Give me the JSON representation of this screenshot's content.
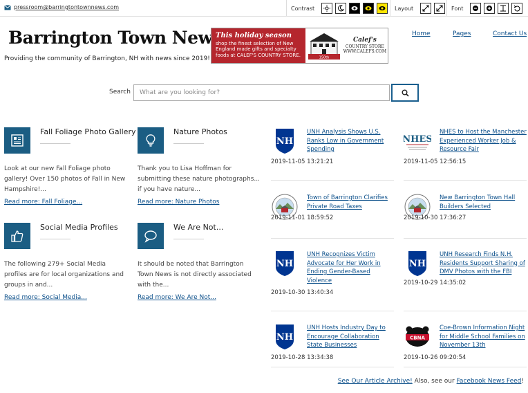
{
  "topbar": {
    "email": "pressroom@barringtontownnews.com",
    "contrast_label": "Contrast",
    "layout_label": "Layout",
    "font_label": "Font"
  },
  "header": {
    "logo": "Barrington Town News",
    "tagline": "Providing the community of Barrington, NH with news since 2019!",
    "ad": {
      "headline": "This holiday season",
      "text": "shop the finest selection of New England made gifts and specialty foods at CALEF'S COUNTRY STORE.",
      "brand": "Calef's",
      "brand_sub": "COUNTRY STORE",
      "anniversary": "150th",
      "url": "WWW.CALEFS.COM"
    },
    "nav": [
      {
        "label": "Home"
      },
      {
        "label": "Pages"
      },
      {
        "label": "Contact Us"
      }
    ]
  },
  "search": {
    "label": "Search",
    "placeholder": "What are you looking for?"
  },
  "features": [
    {
      "title": "Fall Foliage Photo Gallery",
      "icon": "document-icon",
      "desc": "Look at our new Fall Foliage photo gallery! Over 150 photos of Fall in New Hampshire!...",
      "more": "Read more: Fall Foliage..."
    },
    {
      "title": "Nature Photos",
      "icon": "lightbulb-icon",
      "desc": "Thank you to Lisa Hoffman for submitting these nature photographs... if you have nature...",
      "more": "Read more: Nature Photos"
    },
    {
      "title": "Social Media Profiles",
      "icon": "thumbs-up-icon",
      "desc": "The following 279+ Social Media profiles are for local organizations and groups in and...",
      "more": "Read more: Social Media..."
    },
    {
      "title": "We Are Not...",
      "icon": "speech-bubble-icon",
      "desc": "It should be noted that Barrington Town News is not directly associated with the...",
      "more": "Read more: We Are Not..."
    }
  ],
  "news": [
    {
      "title": "UNH Analysis Shows U.S. Ranks Low in Government Spending",
      "date": "2019-11-05 13:21:21",
      "logo": "unh"
    },
    {
      "title": "NHES to Host the Manchester Experienced Worker Job & Resource Fair",
      "date": "2019-11-05 12:56:15",
      "logo": "nhes"
    },
    {
      "title": "Town of Barrington Clarifies Private Road Taxes",
      "date": "2019-11-01 18:59:52",
      "logo": "seal"
    },
    {
      "title": "New Barrington Town Hall Builders Selected",
      "date": "2019-10-30 17:36:27",
      "logo": "seal"
    },
    {
      "title": "UNH Recognizes Victim Advocate for Her Work in Ending Gender-Based Violence",
      "date": "2019-10-30 13:40:34",
      "logo": "unh"
    },
    {
      "title": "UNH Research Finds N.H. Residents Support Sharing of DMV Photos with the FBI",
      "date": "2019-10-29 14:35:02",
      "logo": "unh"
    },
    {
      "title": "UNH Hosts Industry Day to Encourage Collaboration State Businesses",
      "date": "2019-10-28 13:34:38",
      "logo": "unh"
    },
    {
      "title": "Coe-Brown Information Night for Middle School Families on November 13th",
      "date": "2019-10-26 09:20:54",
      "logo": "cbna"
    }
  ],
  "footer": {
    "archive_link": "See Our Article Archive!",
    "middle": " Also, see our ",
    "facebook_link": "Facebook News Feed",
    "end": "!"
  },
  "logo_text": {
    "unh": "NH",
    "nhes": "NHES",
    "cbna": "CBNA"
  },
  "colors": {
    "brand_blue": "#1b5d83",
    "link": "#0b4f8a",
    "ad_red": "#b5262d",
    "unh_blue": "#003591",
    "highlight_yellow": "#ffe600"
  }
}
